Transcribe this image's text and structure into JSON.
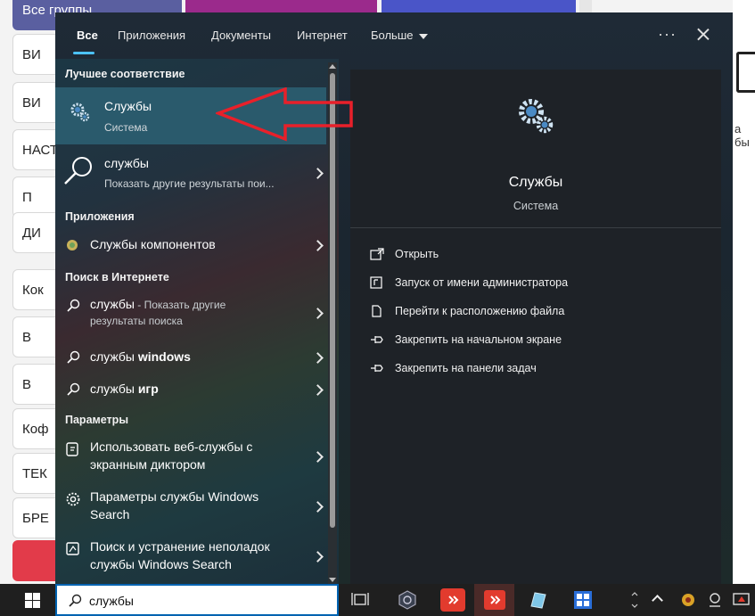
{
  "background": {
    "left_buttons": [
      "Все группы",
      "ВИ",
      "ВИ",
      "НАСТ",
      "П",
      "ДИ",
      "Кок",
      "В",
      "В",
      "Коф",
      "ТЕК",
      "БРЕ",
      ""
    ],
    "right_text": "а бы"
  },
  "tabs": [
    {
      "label": "Все",
      "active": true
    },
    {
      "label": "Приложения"
    },
    {
      "label": "Документы"
    },
    {
      "label": "Интернет"
    },
    {
      "label": "Больше"
    }
  ],
  "more_icon": "ellipsis-icon",
  "close_icon": "close-icon",
  "sections": {
    "best_match": "Лучшее соответствие",
    "apps": "Приложения",
    "web": "Поиск в Интернете",
    "settings": "Параметры"
  },
  "best_match": {
    "title": "Службы",
    "subtitle": "Система",
    "icon": "gears-icon"
  },
  "search_more": {
    "title": "службы",
    "subtitle": "Показать другие результаты пои...",
    "icon": "search-icon"
  },
  "apps": [
    {
      "title": "Службы компонентов",
      "icon": "component-services-icon"
    }
  ],
  "web": [
    {
      "prefix": "службы",
      "rest": " - Показать другие",
      "line2": "результаты поиска"
    },
    {
      "prefix": "службы ",
      "bold": "windows"
    },
    {
      "prefix": "службы ",
      "bold": "игр"
    }
  ],
  "settings": [
    {
      "line1": "Использовать веб-службы с",
      "line2": "экранным диктором",
      "icon": "narrator-icon"
    },
    {
      "line1": "Параметры службы Windows",
      "line2": "Search",
      "icon": "gear-icon"
    },
    {
      "line1": "Поиск и устранение неполадок",
      "line2": "службы Windows Search",
      "icon": "troubleshoot-icon"
    }
  ],
  "detail": {
    "title": "Службы",
    "subtitle": "Система",
    "actions": [
      {
        "label": "Открыть",
        "icon": "open-icon"
      },
      {
        "label": "Запуск от имени администратора",
        "icon": "shield-icon"
      },
      {
        "label": "Перейти к расположению файла",
        "icon": "file-location-icon"
      },
      {
        "label": "Закрепить на начальном экране",
        "icon": "pin-icon"
      },
      {
        "label": "Закрепить на панели задач",
        "icon": "pin-icon"
      }
    ]
  },
  "taskbar": {
    "search_value": "службы",
    "icons": [
      "windows-logo-icon",
      "task-view-icon",
      "app-icon",
      "anydesk-icon",
      "anydesk-icon",
      "app-icon",
      "app-icon"
    ]
  },
  "colors": {
    "accent": "#4cc2ff",
    "highlight": "#2a5a6c",
    "annotation": "#e8202a"
  }
}
